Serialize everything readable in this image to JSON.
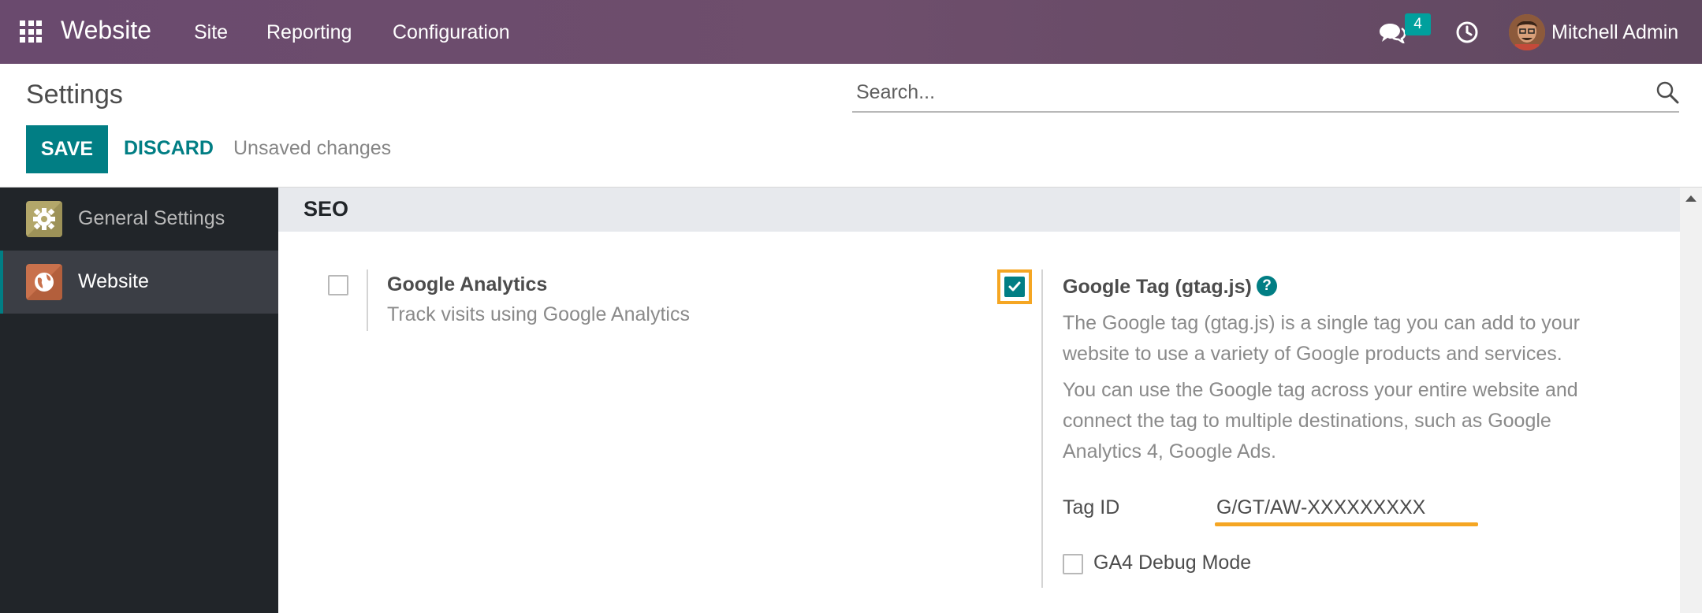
{
  "navbar": {
    "app_title": "Website",
    "menu": [
      {
        "label": "Site"
      },
      {
        "label": "Reporting"
      },
      {
        "label": "Configuration"
      }
    ],
    "chat_badge": "4",
    "user_name": "Mitchell Admin",
    "bg_color": "#6a4a6e"
  },
  "control_panel": {
    "title": "Settings",
    "search_placeholder": "Search...",
    "save_label": "SAVE",
    "discard_label": "DISCARD",
    "status_text": "Unsaved changes"
  },
  "sidebar": {
    "items": [
      {
        "label": "General Settings",
        "icon": "gear-icon",
        "active": false
      },
      {
        "label": "Website",
        "icon": "globe-icon",
        "active": true
      }
    ]
  },
  "main": {
    "section_title": "SEO",
    "settings": [
      {
        "title": "Google Analytics",
        "description": "Track visits using Google Analytics",
        "checked": false
      },
      {
        "title": "Google Tag (gtag.js)",
        "description_1": [
          "The Google tag (gtag.js) is a single tag you can add to your",
          "website to use a variety of Google products and services."
        ],
        "description_2": [
          "You can use the Google tag across your entire website and",
          "connect the tag to multiple destinations, such as Google",
          "Analytics 4, Google Ads."
        ],
        "checked": true,
        "tag_id_label": "Tag ID",
        "tag_id_value": "G/GT/AW-XXXXXXXXX",
        "debug_label": "GA4 Debug Mode",
        "debug_checked": false
      }
    ]
  },
  "colors": {
    "accent": "#017e84",
    "highlight": "#f5a623",
    "sidebar_bg": "#212529"
  }
}
